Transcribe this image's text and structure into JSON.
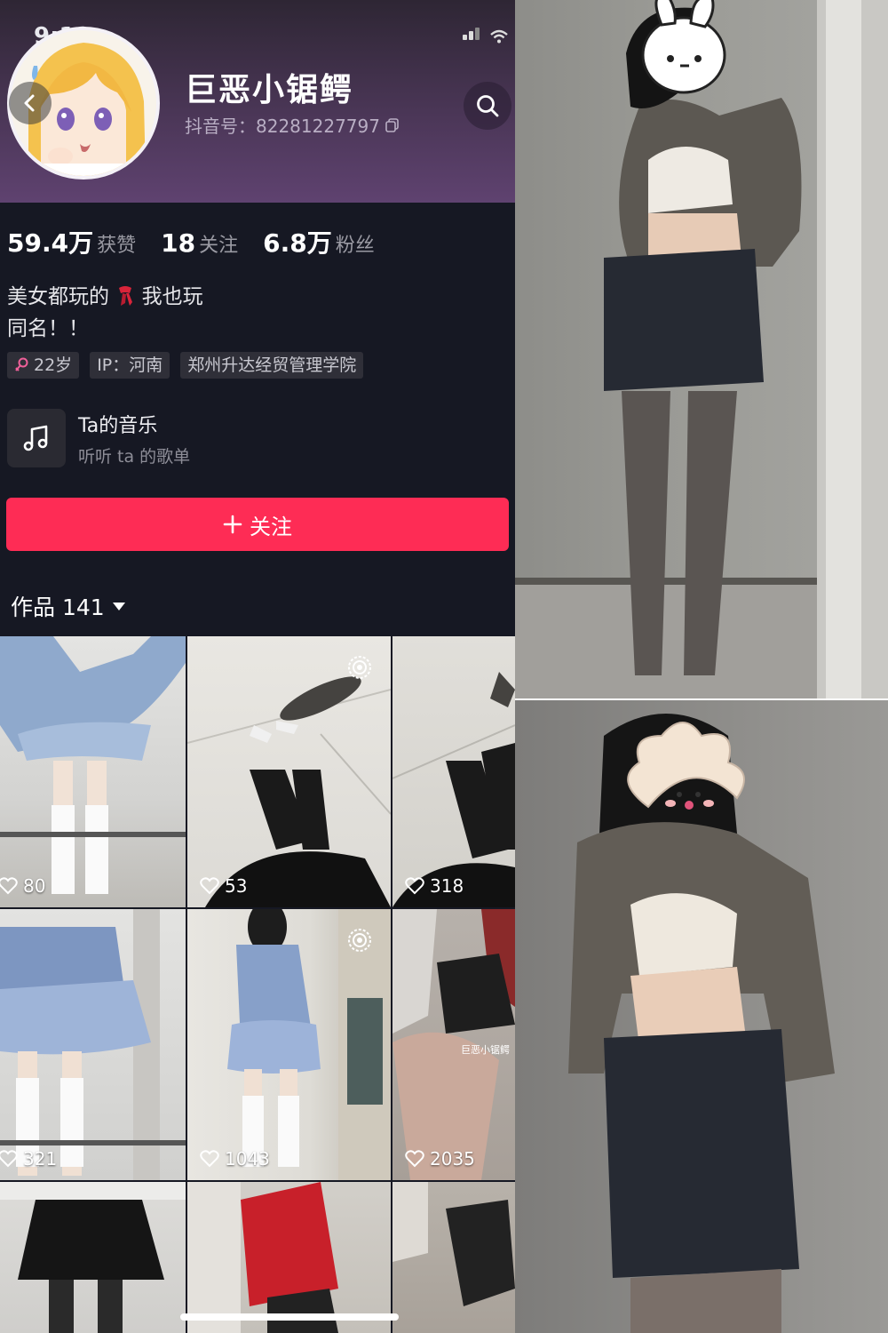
{
  "status_bar": {
    "time": "9:12"
  },
  "profile": {
    "username": "巨恶小锯鳄",
    "douyin_id": "抖音号：82281227797",
    "stats": [
      {
        "value": "59.4万",
        "label": "获赞"
      },
      {
        "value": "18",
        "label": "关注"
      },
      {
        "value": "6.8万",
        "label": "粉丝"
      }
    ],
    "bio_line1_a": "美女都玩的",
    "bio_line1_b": "我也玩",
    "bio_line2": "同名！！",
    "tags": {
      "age": "22岁",
      "ip": "IP：河南",
      "school": "郑州升达经贸管理学院"
    },
    "music": {
      "title": "Ta的音乐",
      "subtitle": "听听 ta 的歌单"
    },
    "follow_label": "关注",
    "works_label": "作品 141"
  },
  "grid": {
    "items": [
      {
        "likes": "80"
      },
      {
        "likes": "53"
      },
      {
        "likes": "318"
      },
      {
        "likes": "321"
      },
      {
        "likes": "1043"
      },
      {
        "likes": "2035"
      }
    ],
    "watermark_text": "巨恶小锯鳄"
  },
  "colors": {
    "accent": "#fe2c55",
    "background": "#161823",
    "header": "#4a3656"
  },
  "icons": [
    "back-icon",
    "search-icon",
    "copy-icon",
    "female-icon",
    "music-note-icon",
    "plus-icon",
    "dropdown-arrow-icon",
    "heart-icon",
    "live-icon"
  ]
}
